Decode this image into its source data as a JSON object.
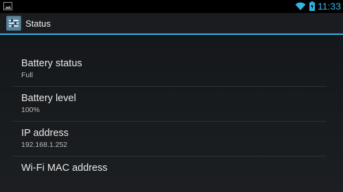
{
  "status_bar": {
    "time": "11:33",
    "notification_icon": "image-icon",
    "wifi_icon": "wifi-icon",
    "battery_icon": "battery-icon",
    "accent_color": "#33b5e5"
  },
  "action_bar": {
    "title": "Status",
    "app_icon": "settings-app-icon"
  },
  "items": [
    {
      "title": "Battery status",
      "summary": "Full"
    },
    {
      "title": "Battery level",
      "summary": "100%"
    },
    {
      "title": "IP address",
      "summary": "192.168.1.252"
    },
    {
      "title": "Wi-Fi MAC address",
      "summary": ""
    }
  ]
}
